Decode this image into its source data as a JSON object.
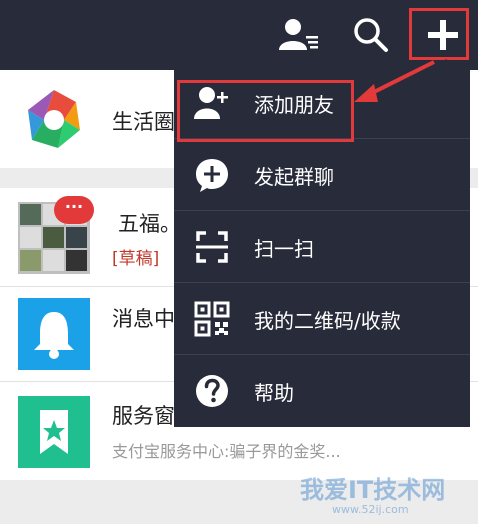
{
  "header": {
    "add_friend_icon": "add-contacts-icon",
    "search_icon": "search-icon",
    "plus_icon": "plus-icon",
    "accent": "#e23a3a",
    "bar_color": "#282b3a"
  },
  "list": {
    "items": [
      {
        "title": "生活圈",
        "sub": ""
      },
      {
        "title": "五福。",
        "draft": "[草稿]",
        "badge": "···"
      },
      {
        "title": "消息中",
        "sub": ""
      },
      {
        "title": "服务窗",
        "sub": "支付宝服务中心:骗子界的金奖..."
      }
    ]
  },
  "menu": {
    "items": [
      {
        "label": "添加朋友",
        "icon": "add-friend-icon"
      },
      {
        "label": "发起群聊",
        "icon": "group-chat-icon"
      },
      {
        "label": "扫一扫",
        "icon": "scan-icon"
      },
      {
        "label": "我的二维码/收款",
        "icon": "qrcode-icon"
      },
      {
        "label": "帮助",
        "icon": "help-icon"
      }
    ]
  },
  "watermark": {
    "text": "我爱IT技术网",
    "sub": "www.52ij.com"
  }
}
